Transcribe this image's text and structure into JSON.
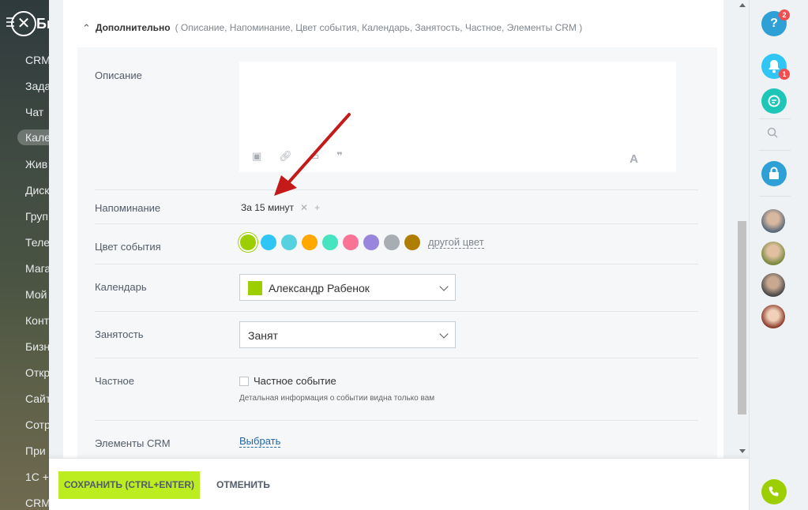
{
  "left_menu": {
    "logo_fragment": "Би",
    "items": [
      "CRM",
      "Зада",
      "Чат",
      "Кале",
      "Жив",
      "Диск",
      "Груп",
      "Теле",
      "Мага",
      "Мой",
      "Конт",
      "Бизн",
      "Откр",
      "Сайт",
      "Сотр",
      "При",
      "1С +",
      "CRM"
    ]
  },
  "advanced": {
    "title": "Дополнительно",
    "list": "( Описание,  Напоминание,  Цвет события,  Календарь,  Занятость,  Частное,  Элементы CRM )"
  },
  "fields": {
    "description_label": "Описание",
    "reminder_label": "Напоминание",
    "reminder_value": "За 15 минут",
    "color_label": "Цвет события",
    "other_color": "другой цвет",
    "calendar_label": "Календарь",
    "calendar_value": "Александр Рабенок",
    "busy_label": "Занятость",
    "busy_value": "Занят",
    "private_label": "Частное",
    "private_checkbox": "Частное событие",
    "private_hint": "Детальная информация о событии видна только вам",
    "crm_label": "Элементы CRM",
    "crm_link": "Выбрать"
  },
  "colors": [
    "#9dcf00",
    "#2fc6f6",
    "#56d1e0",
    "#ffa900",
    "#47e4c2",
    "#f87396",
    "#9985dd",
    "#a8adb4",
    "#af7e00"
  ],
  "footer": {
    "save": "СОХРАНИТЬ (CTRL+ENTER)",
    "cancel": "ОТМЕНИТЬ"
  },
  "right_bar": {
    "help_badge": "2",
    "notify_badge": "1"
  }
}
